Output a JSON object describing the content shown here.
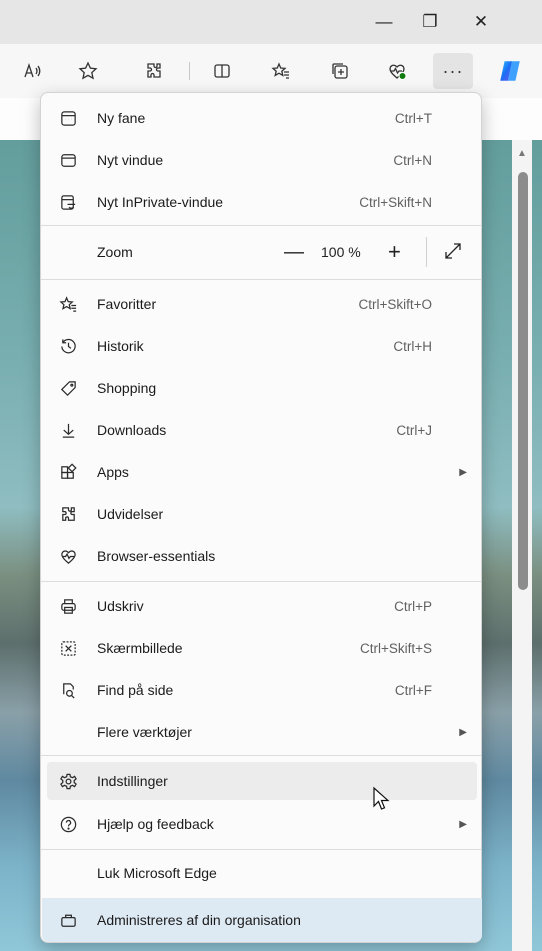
{
  "window": {
    "minimize_glyph": "—",
    "restore_glyph": "❐",
    "close_glyph": "✕"
  },
  "toolbar": {
    "icons": [
      "read-aloud-icon",
      "favorite-star-icon",
      "extensions-icon",
      "split-screen-icon",
      "favorites-icon",
      "collections-icon",
      "browser-essentials-icon",
      "more-icon",
      "copilot-icon"
    ]
  },
  "menu": {
    "items": [
      {
        "label": "Ny fane",
        "shortcut": "Ctrl+T"
      },
      {
        "label": "Nyt vindue",
        "shortcut": "Ctrl+N"
      },
      {
        "label": "Nyt InPrivate-vindue",
        "shortcut": "Ctrl+Skift+N"
      },
      {
        "label": "Zoom",
        "zoom_value": "100 %",
        "minus": "—",
        "plus": "+"
      },
      {
        "label": "Favoritter",
        "shortcut": "Ctrl+Skift+O"
      },
      {
        "label": "Historik",
        "shortcut": "Ctrl+H"
      },
      {
        "label": "Shopping",
        "shortcut": ""
      },
      {
        "label": "Downloads",
        "shortcut": "Ctrl+J"
      },
      {
        "label": "Apps",
        "submenu_arrow": "▶"
      },
      {
        "label": "Udvidelser",
        "shortcut": ""
      },
      {
        "label": "Browser-essentials",
        "shortcut": ""
      },
      {
        "label": "Udskriv",
        "shortcut": "Ctrl+P"
      },
      {
        "label": "Skærmbillede",
        "shortcut": "Ctrl+Skift+S"
      },
      {
        "label": "Find på side",
        "shortcut": "Ctrl+F"
      },
      {
        "label": "Flere værktøjer",
        "submenu_arrow": "▶"
      },
      {
        "label": "Indstillinger",
        "shortcut": ""
      },
      {
        "label": "Hjælp og feedback",
        "submenu_arrow": "▶"
      },
      {
        "label": "Luk Microsoft Edge",
        "shortcut": ""
      },
      {
        "label": "Administreres af din organisation",
        "shortcut": ""
      }
    ]
  },
  "colors": {
    "accent": "#0f6cbd",
    "hover": "#ececec",
    "org_bar": "#dde9f3"
  }
}
